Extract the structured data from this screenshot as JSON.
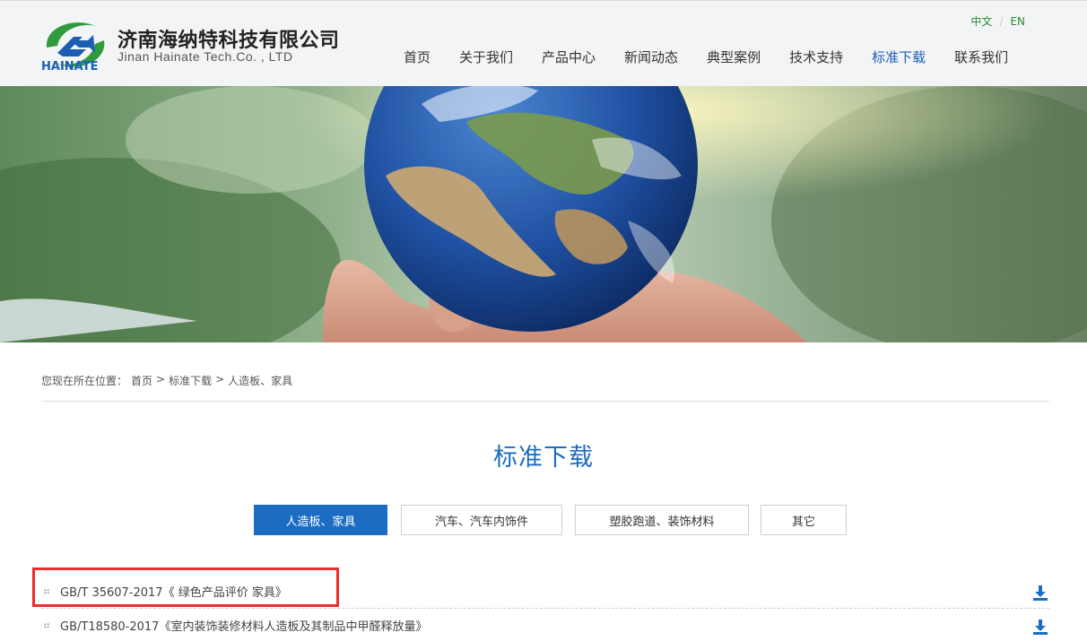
{
  "header": {
    "company_cn": "济南海纳特科技有限公司",
    "company_en": "Jinan Hainate Tech.Co. , LTD",
    "brand_wordmark": "HAINATE",
    "lang": [
      {
        "label": "中文"
      },
      {
        "separator": "/"
      },
      {
        "label": "EN"
      }
    ],
    "nav": [
      {
        "label": "首页",
        "active": false
      },
      {
        "label": "关于我们",
        "active": false
      },
      {
        "label": "产品中心",
        "active": false
      },
      {
        "label": "新闻动态",
        "active": false
      },
      {
        "label": "典型案例",
        "active": false
      },
      {
        "label": "技术支持",
        "active": false
      },
      {
        "label": "标准下载",
        "active": true
      },
      {
        "label": "联系我们",
        "active": false
      }
    ]
  },
  "breadcrumb": {
    "prefix": "您现在所在位置：",
    "items": [
      "首页",
      "标准下载",
      "人造板、家具"
    ],
    "separator": ">"
  },
  "page_title": "标准下载",
  "tabs": [
    {
      "label": "人造板、家具",
      "active": true
    },
    {
      "label": "汽车、汽车内饰件",
      "active": false
    },
    {
      "label": "塑胶跑道、装饰材料",
      "active": false
    },
    {
      "label": "其它",
      "active": false
    }
  ],
  "documents": [
    {
      "title": "GB/T 35607-2017《 绿色产品评价 家具》",
      "highlighted": true
    },
    {
      "title": "GB/T18580-2017《室内装饰装修材料人造板及其制品中甲醛释放量》",
      "highlighted": false
    }
  ],
  "colors": {
    "accent": "#1b6cc2",
    "lang": "#2f8a3a",
    "highlight": "#ef2b2b"
  },
  "icons": {
    "bullet": "grip-dots-icon",
    "download": "download-icon"
  }
}
